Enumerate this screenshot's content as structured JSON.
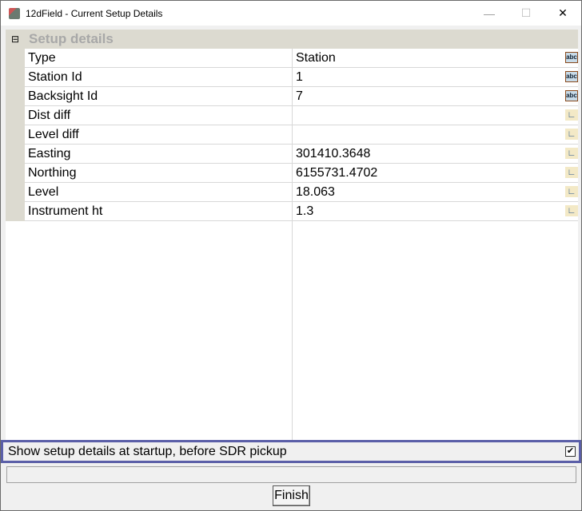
{
  "window": {
    "title": "12dField - Current Setup Details",
    "minimize": "—",
    "maximize": "☐",
    "close": "✕"
  },
  "group": {
    "toggle": "⊟",
    "label": "Setup details"
  },
  "rows": [
    {
      "name": "Type",
      "value": "Station",
      "icon": "abc"
    },
    {
      "name": "Station Id",
      "value": "1",
      "icon": "abc"
    },
    {
      "name": "Backsight Id",
      "value": "7",
      "icon": "abc"
    },
    {
      "name": "Dist diff",
      "value": "",
      "icon": "real"
    },
    {
      "name": "Level diff",
      "value": "",
      "icon": "real"
    },
    {
      "name": "Easting",
      "value": "301410.3648",
      "icon": "real"
    },
    {
      "name": "Northing",
      "value": "6155731.4702",
      "icon": "real"
    },
    {
      "name": "Level",
      "value": "18.063",
      "icon": "real"
    },
    {
      "name": "Instrument ht",
      "value": "1.3",
      "icon": "real"
    }
  ],
  "startup_option": {
    "label": "Show setup details at startup, before SDR pickup",
    "checked": true,
    "mark": "✔"
  },
  "status_text": "",
  "finish_label": "Finish"
}
